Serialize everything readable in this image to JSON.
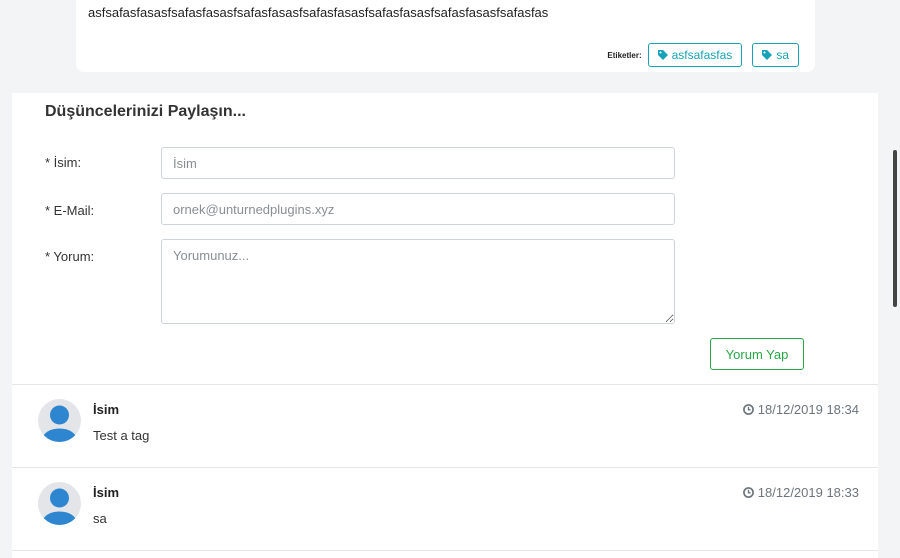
{
  "post": {
    "body": "asfsafasfasasfsafasfasasfsafasfasasfsafasfasasfsafasfasasfsafasfasasfsafasfas",
    "tags_label": "Etiketler:",
    "tags": [
      "asfsafasfas",
      "sa"
    ]
  },
  "form": {
    "title": "Düşüncelerinizi Paylaşın...",
    "name_label": "* İsim:",
    "name_placeholder": "İsim",
    "email_label": "* E-Mail:",
    "email_placeholder": "ornek@unturnedplugins.xyz",
    "comment_label": "* Yorum:",
    "comment_placeholder": "Yorumunuz...",
    "submit_label": "Yorum Yap"
  },
  "comments": [
    {
      "author": "İsim",
      "date": "18/12/2019 18:34",
      "text": "Test a tag"
    },
    {
      "author": "İsim",
      "date": "18/12/2019 18:33",
      "text": "sa"
    }
  ],
  "colors": {
    "tag": "#17a2b8",
    "submit": "#28a745",
    "avatar": "#2f86d0"
  },
  "icons": {
    "tag": "tag-icon",
    "clock": "clock-icon",
    "avatar": "user-avatar-icon"
  }
}
